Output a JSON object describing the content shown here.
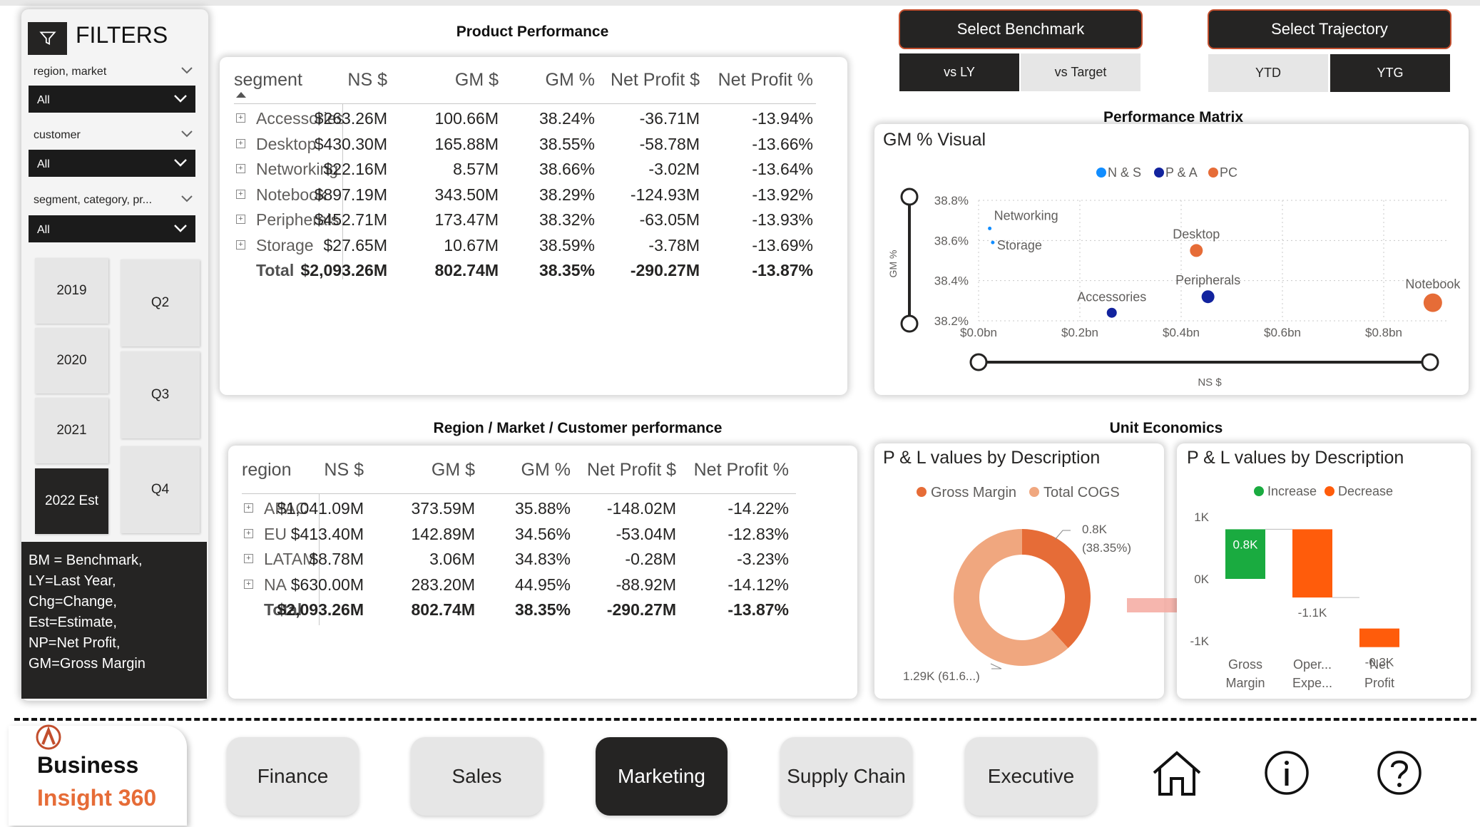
{
  "filters": {
    "title": "FILTERS",
    "items": [
      {
        "label": "region, market",
        "value": "All"
      },
      {
        "label": "customer",
        "value": "All"
      },
      {
        "label": "segment, category, pr...",
        "value": "All"
      }
    ],
    "years": [
      "2019",
      "2020",
      "2021",
      "2022 Est"
    ],
    "quarters": [
      "Q2",
      "Q3",
      "Q4"
    ],
    "glossary": [
      "BM = Benchmark,",
      "LY=Last Year,",
      "Chg=Change,",
      "Est=Estimate,",
      "NP=Net Profit,",
      "GM=Gross Margin"
    ]
  },
  "product_table": {
    "title": "Product Performance",
    "headers": [
      "segment",
      "NS $",
      "GM $",
      "GM %",
      "Net Profit $",
      "Net Profit %"
    ],
    "rows": [
      [
        "Accessories",
        "$263.26M",
        "100.66M",
        "38.24%",
        "-36.71M",
        "-13.94%"
      ],
      [
        "Desktop",
        "$430.30M",
        "165.88M",
        "38.55%",
        "-58.78M",
        "-13.66%"
      ],
      [
        "Networking",
        "$22.16M",
        "8.57M",
        "38.66%",
        "-3.02M",
        "-13.64%"
      ],
      [
        "Notebook",
        "$897.19M",
        "343.50M",
        "38.29%",
        "-124.93M",
        "-13.92%"
      ],
      [
        "Peripherals",
        "$452.71M",
        "173.47M",
        "38.32%",
        "-63.05M",
        "-13.93%"
      ],
      [
        "Storage",
        "$27.65M",
        "10.67M",
        "38.59%",
        "-3.78M",
        "-13.69%"
      ]
    ],
    "total": [
      "Total",
      "$2,093.26M",
      "802.74M",
      "38.35%",
      "-290.27M",
      "-13.87%"
    ]
  },
  "region_table": {
    "title": "Region / Market / Customer performance",
    "headers": [
      "region",
      "NS $",
      "GM $",
      "GM %",
      "Net Profit $",
      "Net Profit %"
    ],
    "rows": [
      [
        "APAC",
        "$1,041.09M",
        "373.59M",
        "35.88%",
        "-148.02M",
        "-14.22%"
      ],
      [
        "EU",
        "$413.40M",
        "142.89M",
        "34.56%",
        "-53.04M",
        "-12.83%"
      ],
      [
        "LATAM",
        "$8.78M",
        "3.06M",
        "34.83%",
        "-0.28M",
        "-3.23%"
      ],
      [
        "NA",
        "$630.00M",
        "283.20M",
        "44.95%",
        "-88.92M",
        "-14.12%"
      ]
    ],
    "total": [
      "Total",
      "$2,093.26M",
      "802.74M",
      "38.35%",
      "-290.27M",
      "-13.87%"
    ]
  },
  "benchmark": {
    "select_label": "Select Benchmark",
    "options": [
      "vs LY",
      "vs Target"
    ],
    "selected": "vs LY"
  },
  "trajectory": {
    "select_label": "Select Trajectory",
    "options": [
      "YTD",
      "YTG"
    ],
    "selected": "YTG"
  },
  "performance_matrix": {
    "section_title": "Performance Matrix",
    "visual_title": "GM % Visual",
    "legend": [
      {
        "name": "N & S",
        "color": "#118dff"
      },
      {
        "name": "P & A",
        "color": "#12239e"
      },
      {
        "name": "PC",
        "color": "#e66c37"
      }
    ],
    "y_axis_label": "GM %",
    "x_axis_label": "NS $",
    "y_ticks": [
      "38.8%",
      "38.6%",
      "38.4%",
      "38.2%"
    ],
    "x_ticks": [
      "$0.0bn",
      "$0.2bn",
      "$0.4bn",
      "$0.6bn",
      "$0.8bn"
    ]
  },
  "chart_data": [
    {
      "type": "scatter",
      "title": "GM % Visual",
      "xlabel": "NS $",
      "ylabel": "GM %",
      "xlim": [
        0,
        0.9
      ],
      "ylim": [
        38.2,
        38.8
      ],
      "series": [
        {
          "name": "N & S",
          "color": "#118dff",
          "points": [
            {
              "label": "Networking",
              "x": 0.022,
              "y": 38.66
            },
            {
              "label": "Storage",
              "x": 0.028,
              "y": 38.59
            }
          ]
        },
        {
          "name": "P & A",
          "color": "#12239e",
          "points": [
            {
              "label": "Accessories",
              "x": 0.263,
              "y": 38.24
            },
            {
              "label": "Peripherals",
              "x": 0.453,
              "y": 38.32
            }
          ]
        },
        {
          "name": "PC",
          "color": "#e66c37",
          "points": [
            {
              "label": "Desktop",
              "x": 0.43,
              "y": 38.55
            },
            {
              "label": "Notebook",
              "x": 0.897,
              "y": 38.29
            }
          ]
        }
      ]
    },
    {
      "type": "pie",
      "title": "P & L values by Description",
      "legend": [
        "Gross Margin",
        "Total COGS"
      ],
      "values": [
        {
          "name": "Gross Margin",
          "value": 0.8,
          "label": "0.8K",
          "pct": "(38.35%)",
          "color": "#e66c37"
        },
        {
          "name": "Total COGS",
          "value": 1.29,
          "label": "1.29K (61.6...)",
          "color": "#f0a77f"
        }
      ]
    },
    {
      "type": "bar",
      "title": "P & L values by Description",
      "legend": [
        {
          "name": "Increase",
          "color": "#1aab40"
        },
        {
          "name": "Decrease",
          "color": "#ff5c0b"
        }
      ],
      "categories": [
        "Gross Margin",
        "Oper... Expe...",
        "Net Profit"
      ],
      "values": [
        0.8,
        -1.1,
        -0.3
      ],
      "labels": [
        "0.8K",
        "-1.1K",
        "-0.3K"
      ],
      "y_ticks": [
        "1K",
        "0K",
        "-1K"
      ],
      "ylim": [
        -1.1,
        1.1
      ]
    }
  ],
  "unit_economics": {
    "section_title": "Unit Economics",
    "donut_title": "P & L values by Description",
    "donut_legend": [
      "Gross Margin",
      "Total COGS"
    ],
    "donut_label_top_1": "0.8K",
    "donut_label_top_2": "(38.35%)",
    "donut_label_bottom": "1.29K (61.6...)",
    "waterfall_title": "P & L values by Description",
    "waterfall_legend": [
      "Increase",
      "Decrease"
    ],
    "waterfall_cats": [
      [
        "Gross",
        "Margin"
      ],
      [
        "Oper...",
        "Expe..."
      ],
      [
        "Net",
        "Profit"
      ]
    ],
    "waterfall_labels": [
      "0.8K",
      "-1.1K",
      "-0.3K"
    ],
    "waterfall_ticks": [
      "1K",
      "0K",
      "-1K"
    ]
  },
  "nav": {
    "brand_line1": "Business",
    "brand_line2": "Insight 360",
    "buttons": [
      "Finance",
      "Sales",
      "Marketing",
      "Supply Chain",
      "Executive"
    ],
    "active": "Marketing"
  }
}
